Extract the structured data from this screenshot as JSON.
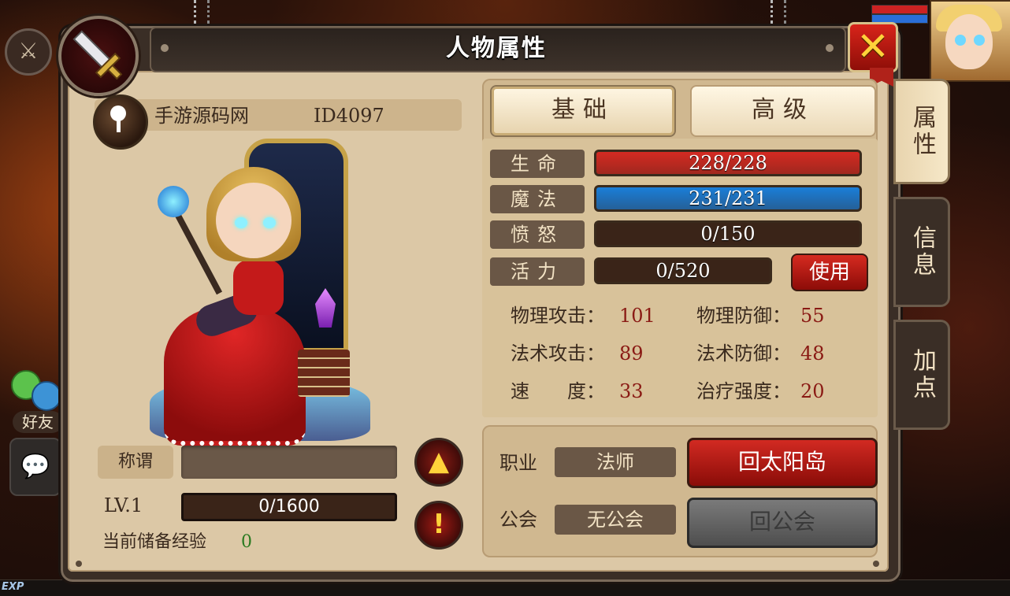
{
  "window": {
    "title": "人物属性"
  },
  "player": {
    "name": "手游源码网",
    "id": "ID4097"
  },
  "title_row": {
    "label": "称谓",
    "value": ""
  },
  "level": {
    "label": "LV.1",
    "exp_text": "0/1600",
    "exp_fraction": 0
  },
  "stored_exp": {
    "label": "当前储备经验",
    "value": "0"
  },
  "tabs": {
    "basic": "基础",
    "advanced": "高级",
    "active": "basic"
  },
  "bars": [
    {
      "label": "生命",
      "value": "228/228",
      "fraction": 1.0,
      "color": "#d42a22"
    },
    {
      "label": "魔法",
      "value": "231/231",
      "fraction": 1.0,
      "color": "#1a7ed8"
    },
    {
      "label": "愤怒",
      "value": "0/150",
      "fraction": 0,
      "color": "#d42a22"
    },
    {
      "label": "活力",
      "value": "0/520",
      "fraction": 0,
      "color": "#d42a22"
    }
  ],
  "use_button": "使用",
  "attributes": [
    {
      "name": "物理攻击：",
      "value": "101"
    },
    {
      "name": "物理防御：",
      "value": "55"
    },
    {
      "name": "法术攻击：",
      "value": "89"
    },
    {
      "name": "法术防御：",
      "value": "48"
    },
    {
      "name": "速　　度：",
      "value": "33"
    },
    {
      "name": "治疗强度：",
      "value": "20"
    }
  ],
  "profession": {
    "label": "职业",
    "value": "法师",
    "button": "回太阳岛"
  },
  "guild": {
    "label": "公会",
    "value": "无公会",
    "button": "回公会"
  },
  "side_tabs": [
    {
      "label": "属性",
      "active": true
    },
    {
      "label": "信息",
      "active": false
    },
    {
      "label": "加点",
      "active": false
    }
  ],
  "background": {
    "friend_label": "好友",
    "exp_label": "EXP"
  },
  "icons": {
    "close": "close-icon",
    "sword": "sword-icon",
    "key": "key-icon",
    "up": "arrow-up-icon",
    "warn": "exclamation-icon",
    "chat": "chat-icon"
  },
  "colors": {
    "accent_red": "#d42a22",
    "mana_blue": "#1a7ed8",
    "close_yellow": "#ffd23a"
  }
}
